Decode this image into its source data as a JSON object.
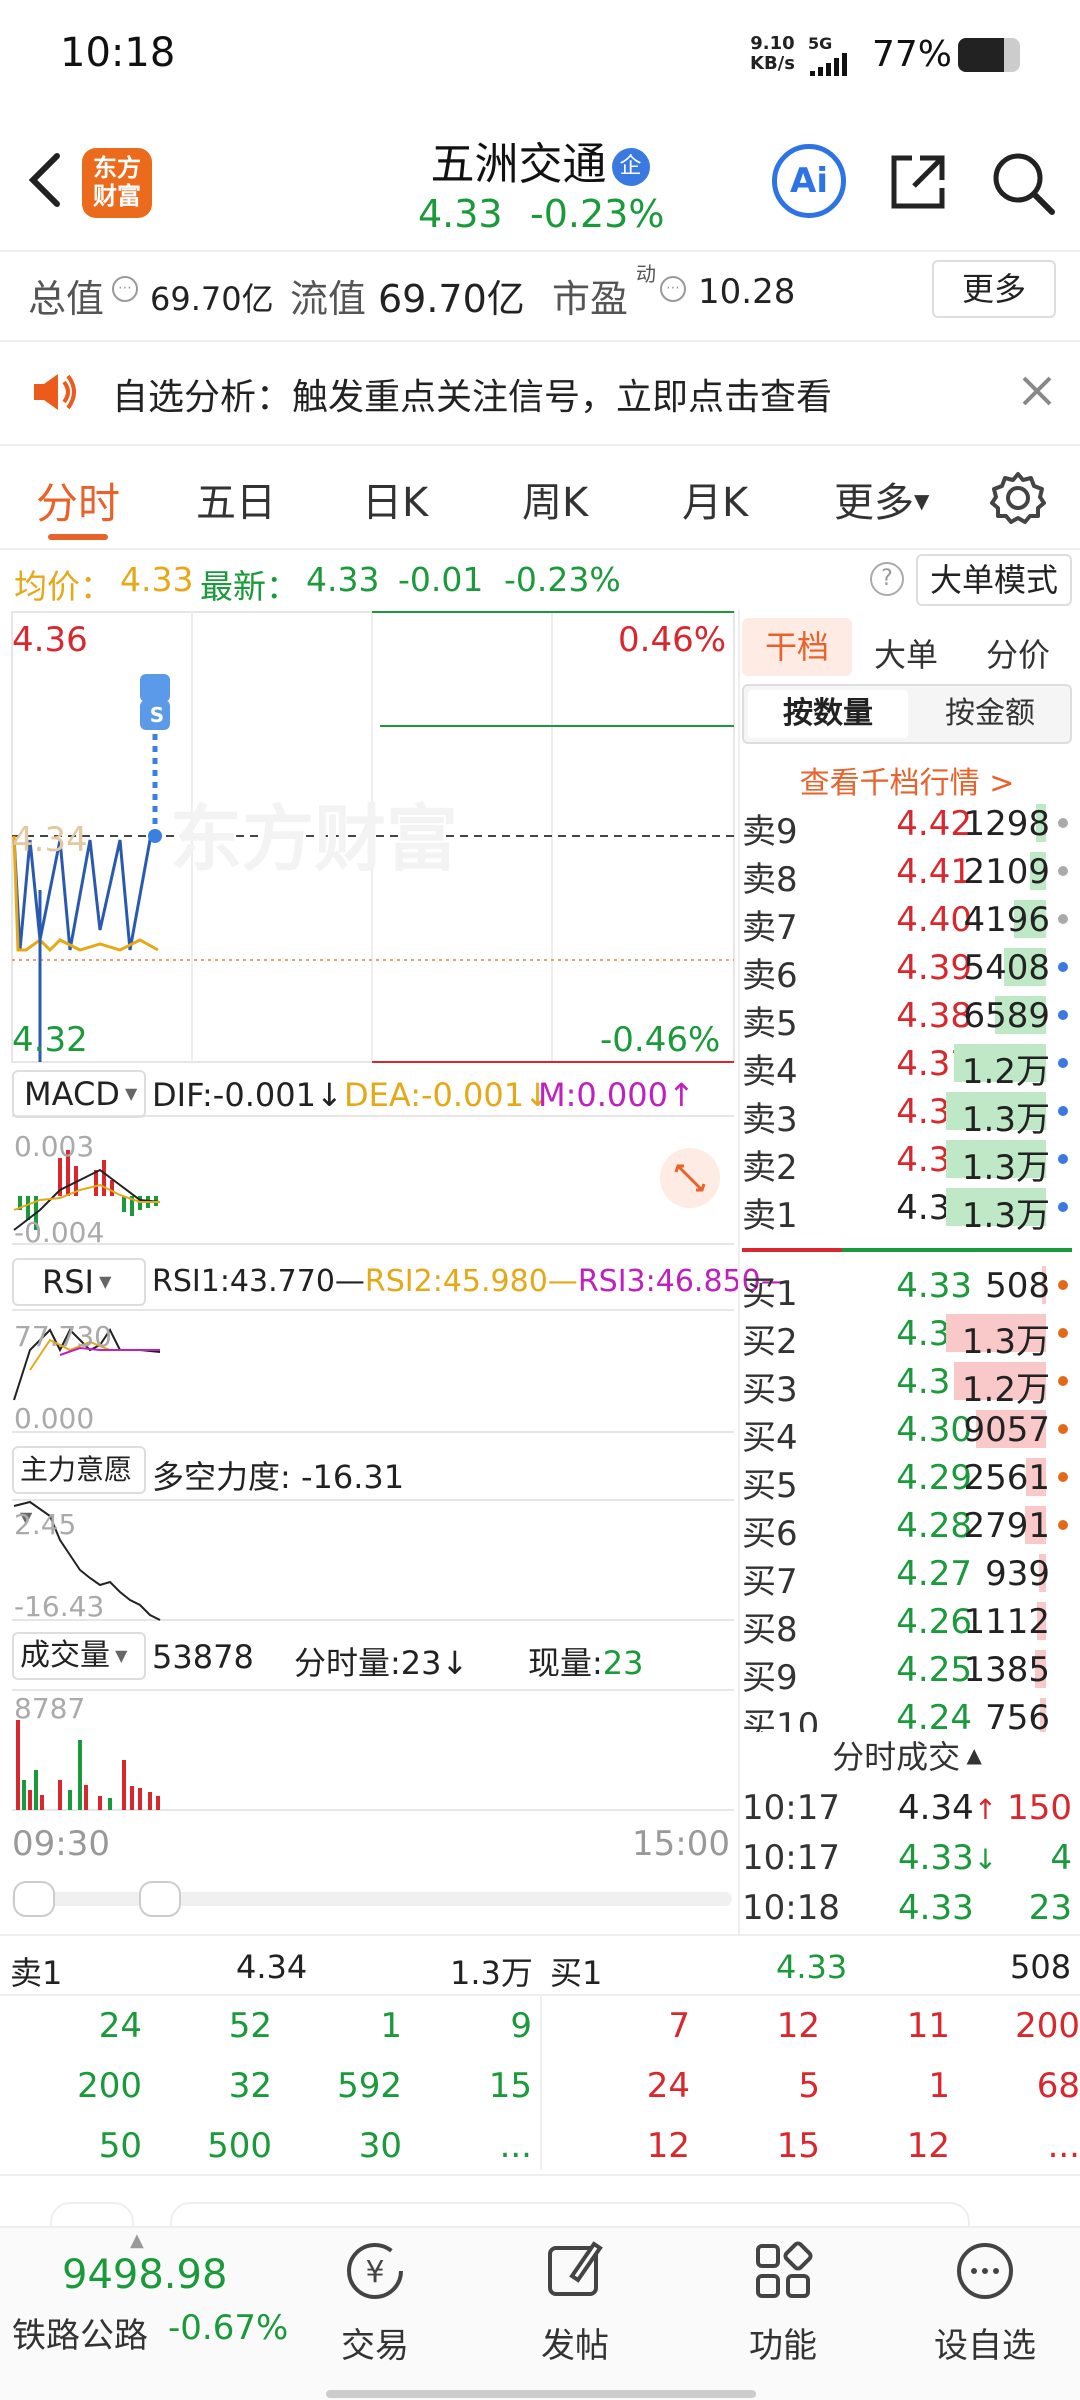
{
  "status": {
    "time": "10:18",
    "speed_value": "9.10",
    "speed_unit": "KB/s",
    "net": "5G",
    "battery": "77%"
  },
  "header": {
    "stock_name": "五洲交通",
    "badge": "企",
    "logo_line1": "东方",
    "logo_line2": "财富",
    "price": "4.33",
    "change_pct": "-0.23%",
    "ai_label": "Ai"
  },
  "info": {
    "total_value_label": "总值",
    "total_value": "69.70亿",
    "float_value_label": "流值",
    "float_value": "69.70亿",
    "pe_label": "市盈",
    "pe_sup": "动",
    "pe_value": "10.28",
    "more_button": "更多"
  },
  "notice": {
    "text": "自选分析：触发重点关注信号，立即点击查看"
  },
  "tabs": [
    "分时",
    "五日",
    "日K",
    "周K",
    "月K",
    "更多"
  ],
  "active_tab": 0,
  "price_line": {
    "avg_label": "均价：",
    "avg_value": "4.33",
    "latest_label": "最新：",
    "latest_value": "4.33",
    "change": "-0.01",
    "change_pct": "-0.23%",
    "mode_button": "大单模式"
  },
  "chart": {
    "y_high": "4.36",
    "y_mid": "4.34",
    "y_low": "4.32",
    "pct_high": "0.46%",
    "pct_low": "-0.46%",
    "watermark": "东方财富",
    "time_start": "09:30",
    "time_end": "15:00",
    "s_marker": "S"
  },
  "macd": {
    "name": "MACD",
    "dif": "DIF:-0.001",
    "dea": "DEA:-0.001",
    "m": "M:0.000",
    "top": "0.003",
    "bottom": "-0.004"
  },
  "rsi": {
    "name": "RSI",
    "rsi1": "RSI1:43.770—",
    "rsi2": "RSI2:45.980—",
    "rsi3": "RSI3:46.850—",
    "top": "77.730",
    "bottom": "0.000"
  },
  "intent": {
    "name": "主力意愿",
    "label": "多空力度:",
    "value": "-16.31",
    "top": "2.45",
    "bottom": "-16.43"
  },
  "volume": {
    "name": "成交量",
    "total": "53878",
    "fs_label": "分时量:",
    "fs_value": "23",
    "now_label": "现量:",
    "now_value": "23",
    "top": "8787"
  },
  "orderbook": {
    "tabs": [
      "干档",
      "大单",
      "分价"
    ],
    "subtabs": [
      "按数量",
      "按金额"
    ],
    "link": "查看千档行情 >",
    "asks": [
      {
        "label": "卖9",
        "price": "4.42",
        "vol": "1298"
      },
      {
        "label": "卖8",
        "price": "4.41",
        "vol": "2109"
      },
      {
        "label": "卖7",
        "price": "4.40",
        "vol": "4196"
      },
      {
        "label": "卖6",
        "price": "4.39",
        "vol": "5408"
      },
      {
        "label": "卖5",
        "price": "4.38",
        "vol": "6589"
      },
      {
        "label": "卖4",
        "price": "4.37",
        "vol": "1.2万"
      },
      {
        "label": "卖3",
        "price": "4.36",
        "vol": "1.3万"
      },
      {
        "label": "卖2",
        "price": "4.35",
        "vol": "1.3万"
      },
      {
        "label": "卖1",
        "price": "4.34",
        "vol": "1.3万"
      }
    ],
    "bids": [
      {
        "label": "买1",
        "price": "4.33",
        "vol": "508"
      },
      {
        "label": "买2",
        "price": "4.32",
        "vol": "1.3万"
      },
      {
        "label": "买3",
        "price": "4.31",
        "vol": "1.2万"
      },
      {
        "label": "买4",
        "price": "4.30",
        "vol": "9057"
      },
      {
        "label": "买5",
        "price": "4.29",
        "vol": "2561"
      },
      {
        "label": "买6",
        "price": "4.28",
        "vol": "2791"
      },
      {
        "label": "买7",
        "price": "4.27",
        "vol": "939"
      },
      {
        "label": "买8",
        "price": "4.26",
        "vol": "1112"
      },
      {
        "label": "买9",
        "price": "4.25",
        "vol": "1385"
      },
      {
        "label": "买10",
        "price": "4.24",
        "vol": "756"
      }
    ],
    "ticks_title": "分时成交",
    "ticks": [
      {
        "time": "10:17",
        "price": "4.34",
        "arrow": "↑",
        "vol": "150"
      },
      {
        "time": "10:17",
        "price": "4.33",
        "arrow": "↓",
        "vol": "4"
      },
      {
        "time": "10:18",
        "price": "4.33",
        "arrow": "",
        "vol": "23"
      }
    ]
  },
  "queue": {
    "sell_label": "卖1",
    "sell_price": "4.34",
    "sell_vol": "1.3万",
    "buy_label": "买1",
    "buy_price": "4.33",
    "buy_vol": "508",
    "sell_rows": [
      [
        "24",
        "52",
        "1",
        "9"
      ],
      [
        "200",
        "32",
        "592",
        "15"
      ],
      [
        "50",
        "500",
        "30",
        "..."
      ]
    ],
    "buy_rows": [
      [
        "7",
        "12",
        "11",
        "200"
      ],
      [
        "24",
        "5",
        "1",
        "68"
      ],
      [
        "12",
        "15",
        "12",
        "..."
      ]
    ]
  },
  "bottom": {
    "index_value": "9498.98",
    "index_name": "铁路公路",
    "index_change": "-0.67%",
    "items": [
      "交易",
      "发帖",
      "功能",
      "设自选"
    ]
  }
}
